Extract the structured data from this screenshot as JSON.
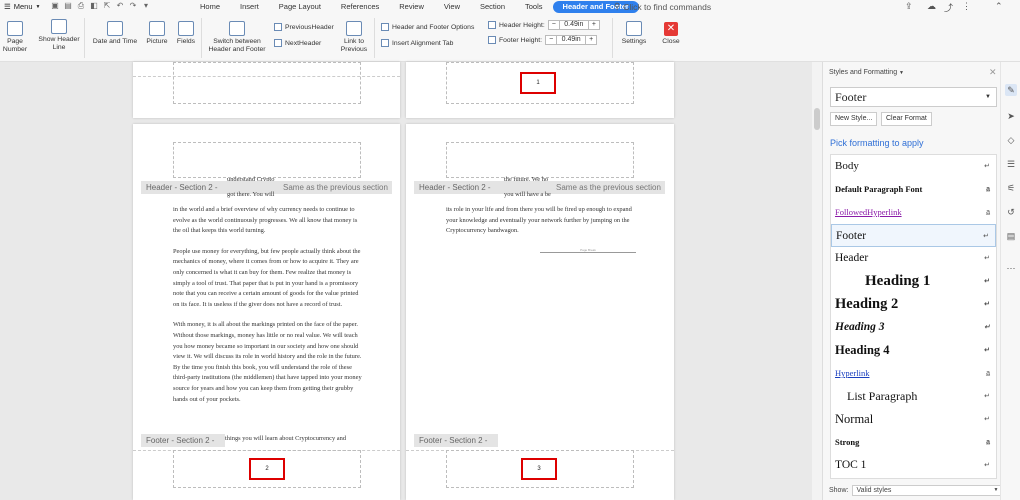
{
  "menubar": {
    "menu_label": "Menu",
    "tabs": [
      "Home",
      "Insert",
      "Page Layout",
      "References",
      "Review",
      "View",
      "Section",
      "Tools",
      "Header and Footer"
    ],
    "search_placeholder": "Click to find commands"
  },
  "ribbon": {
    "page_number": "Page Number",
    "show_header_line": "Show Header Line",
    "date_time": "Date and Time",
    "picture": "Picture",
    "fields": "Fields",
    "switch": "Switch between Header and Footer",
    "previous_header": "PreviousHeader",
    "next_header": "NextHeader",
    "link_to_previous": "Link to Previous",
    "header_footer_options": "Header and Footer Options",
    "insert_alignment_tab": "Insert Alignment Tab",
    "header_height_label": "Header Height:",
    "header_height_value": "0.49in",
    "footer_height_label": "Footer Height:",
    "footer_height_value": "0.49in",
    "settings": "Settings",
    "close": "Close"
  },
  "document": {
    "page_num_top_right": "1",
    "page_num_bottom_left": "2",
    "page_num_bottom_right": "3",
    "header_label": "Header  - Section 2 -",
    "footer_label": "Footer  - Section 2 -",
    "same_as_previous": "Same as the previous section",
    "left_frag1": "understand Crypto",
    "left_frag2": "got there. You will",
    "right_frag1": "the future. We ho",
    "right_frag2": "you will have a be",
    "left_footer_frag": "things you will learn about Cryptocurrency and",
    "page_break": "Page Break",
    "left_paragraphs": [
      "in the world and a brief overview of why currency needs to continue to evolve as the world continuously progresses. We all know that money is the oil that keeps this world turning.",
      "People use money for everything, but few people actually think about the mechanics of money, where it comes from or how to acquire it. They are only concerned is what it can buy for them. Few realize that money is simply a tool of trust. That paper that is put in your hand is a promissory note that you can receive a certain amount of goods for the value printed on its face. It is useless if the giver does not have a record of trust.",
      "With money, it is all about the markings printed on the face of the paper. Without those markings, money has little or no real value. We will teach you how money became so important in our society and how one should view it. We will discuss its role in world history and the role in the future. By the time you finish this book, you will understand the role of these third-party institutions (the middlemen) that have tapped into your money source for years and how you can keep them from getting their grubby hands out of your pockets."
    ],
    "right_paragraph": "its role in your life and from there you will be fired up enough to expand your knowledge and eventually your network further by jumping on the Cryptocurrency bandwagon."
  },
  "panel": {
    "title": "Styles and Formatting",
    "current_style": "Footer",
    "new_style": "New Style...",
    "clear_format": "Clear Format",
    "pick_label": "Pick formatting to apply",
    "styles": [
      "Body",
      "Default Paragraph Font",
      "FollowedHyperlink",
      "Footer",
      "Header",
      "Heading 1",
      "Heading 2",
      "Heading 3",
      "Heading 4",
      "Hyperlink",
      "List Paragraph",
      "Normal",
      "Strong",
      "TOC 1"
    ],
    "show_label": "Show:",
    "show_value": "Valid styles"
  },
  "colors": {
    "accent": "#2f80ed",
    "highlight": "#dd0000",
    "close": "#e53935"
  }
}
